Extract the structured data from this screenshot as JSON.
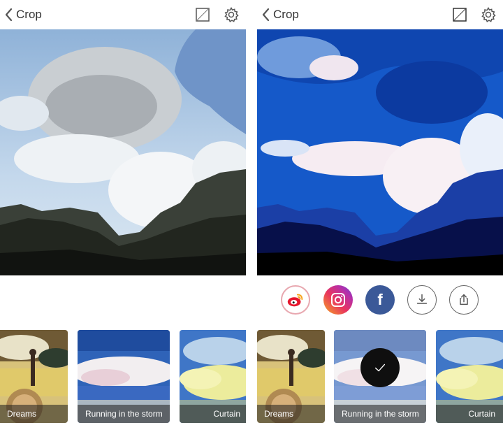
{
  "left_screen": {
    "topbar": {
      "back_label": "Crop"
    },
    "filters": [
      {
        "label": "Dreams"
      },
      {
        "label": "Running in the storm"
      },
      {
        "label": "Curtain"
      }
    ]
  },
  "right_screen": {
    "topbar": {
      "back_label": "Crop"
    },
    "share_buttons": [
      "weibo-icon",
      "instagram-icon",
      "facebook-icon",
      "download-icon",
      "share-icon"
    ],
    "facebook_glyph": "f",
    "filters": [
      {
        "label": "Dreams"
      },
      {
        "label": "Running in the storm",
        "selected": true
      },
      {
        "label": "Curtain"
      }
    ]
  },
  "colors": {
    "instagram": "#d6337f",
    "facebook": "#3b5998",
    "weibo_red": "#e6162d",
    "weibo_orange": "#f7a21b",
    "selected_check_bg": "#0f0f0f"
  }
}
